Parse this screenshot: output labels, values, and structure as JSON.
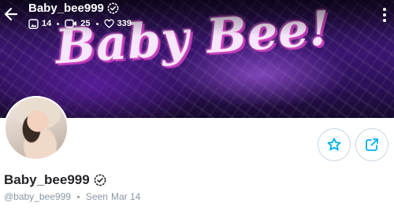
{
  "banner": {
    "art_text": "Baby Bee!"
  },
  "topbar": {
    "username": "Baby_bee999",
    "stats": {
      "photos": "14",
      "videos": "25",
      "likes": "339"
    }
  },
  "profile": {
    "display_name": "Baby_bee999",
    "handle": "@baby_bee999",
    "seen_label": "Seen",
    "seen_value": "Mar 14"
  },
  "colors": {
    "accent": "#00aff0",
    "muted_text": "#8a96a3",
    "name_text": "#242529",
    "button_border": "#c9d4e0"
  },
  "icons": {
    "back": "arrow-left-icon",
    "verified": "verified-badge-icon",
    "photos": "image-icon",
    "videos": "video-icon",
    "likes": "heart-icon",
    "more": "more-vertical-icon",
    "favorite": "star-icon",
    "share": "share-icon"
  }
}
